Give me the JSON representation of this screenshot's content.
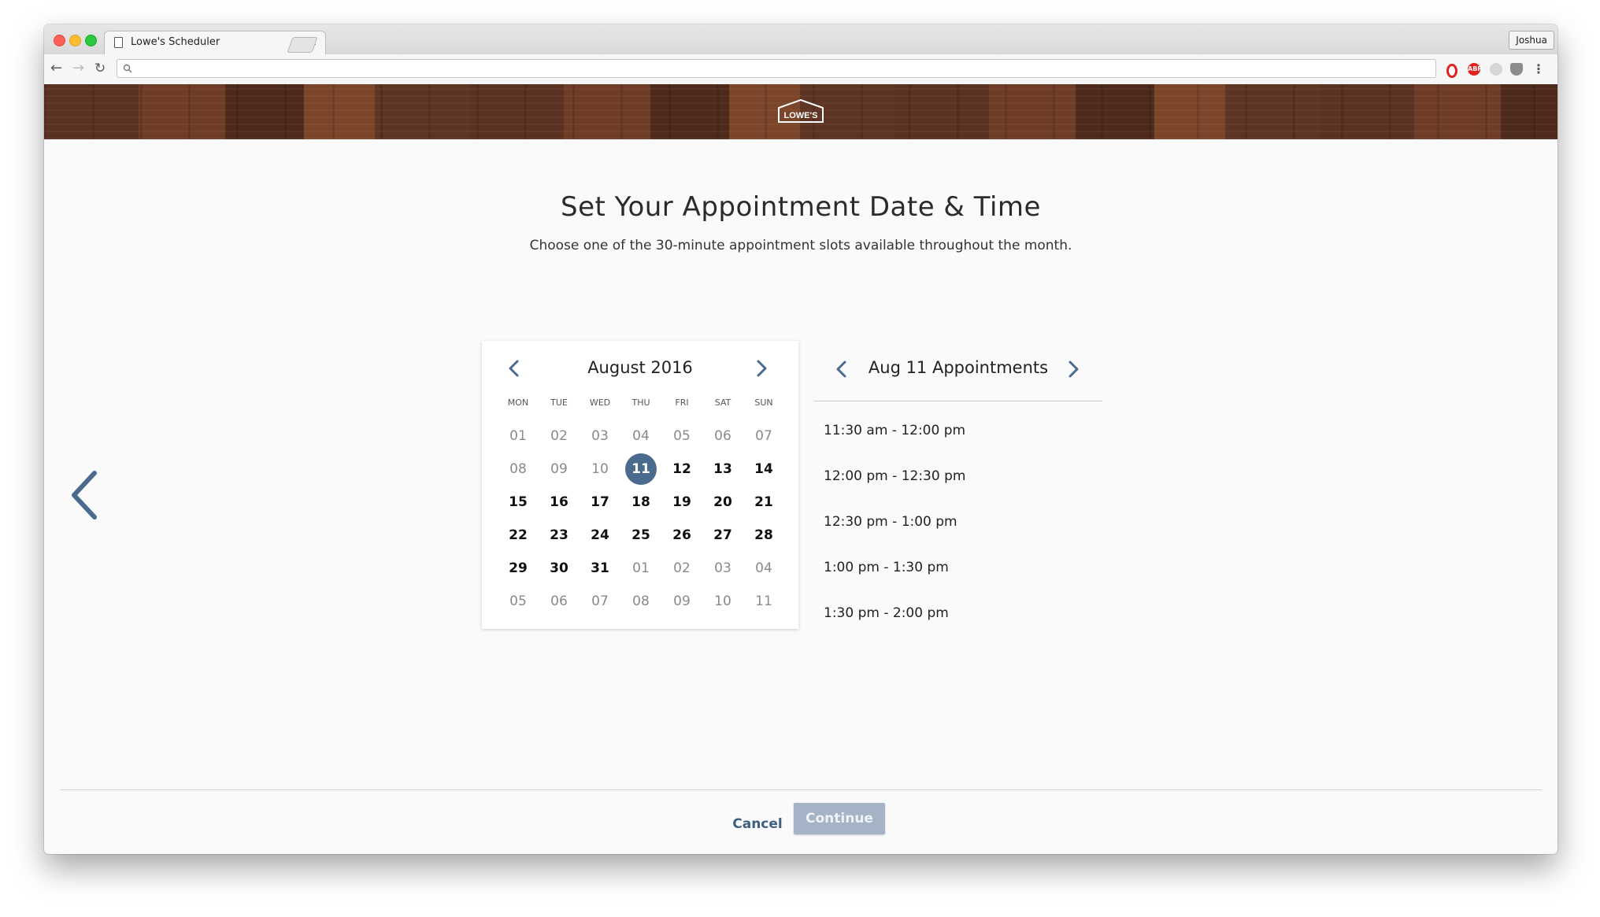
{
  "browser": {
    "tab_title": "Lowe's Scheduler",
    "tab_close": "×",
    "profile_name": "Joshua",
    "address": "",
    "extensions": [
      "opera-icon",
      "adblock-plus-icon",
      "ghostery-icon",
      "privacy-badger-icon",
      "more-menu-icon"
    ],
    "ext_labels": {
      "abp": "ABP",
      "menu": "⋮"
    }
  },
  "banner": {
    "logo_text": "LOWE'S"
  },
  "page": {
    "title": "Set Your Appointment Date & Time",
    "subtitle": "Choose one of the 30-minute appointment slots available throughout the month."
  },
  "calendar": {
    "month_label": "August 2016",
    "weekdays": [
      "MON",
      "TUE",
      "WED",
      "THU",
      "FRI",
      "SAT",
      "SUN"
    ],
    "weeks": [
      [
        {
          "d": "01",
          "s": "muted"
        },
        {
          "d": "02",
          "s": "muted"
        },
        {
          "d": "03",
          "s": "muted"
        },
        {
          "d": "04",
          "s": "muted"
        },
        {
          "d": "05",
          "s": "muted"
        },
        {
          "d": "06",
          "s": "muted"
        },
        {
          "d": "07",
          "s": "muted"
        }
      ],
      [
        {
          "d": "08",
          "s": "muted"
        },
        {
          "d": "09",
          "s": "muted"
        },
        {
          "d": "10",
          "s": "muted"
        },
        {
          "d": "11",
          "s": "sel"
        },
        {
          "d": "12",
          "s": "avail"
        },
        {
          "d": "13",
          "s": "avail"
        },
        {
          "d": "14",
          "s": "avail"
        }
      ],
      [
        {
          "d": "15",
          "s": "avail"
        },
        {
          "d": "16",
          "s": "avail"
        },
        {
          "d": "17",
          "s": "avail"
        },
        {
          "d": "18",
          "s": "avail"
        },
        {
          "d": "19",
          "s": "avail"
        },
        {
          "d": "20",
          "s": "avail"
        },
        {
          "d": "21",
          "s": "avail"
        }
      ],
      [
        {
          "d": "22",
          "s": "avail"
        },
        {
          "d": "23",
          "s": "avail"
        },
        {
          "d": "24",
          "s": "avail"
        },
        {
          "d": "25",
          "s": "avail"
        },
        {
          "d": "26",
          "s": "avail"
        },
        {
          "d": "27",
          "s": "avail"
        },
        {
          "d": "28",
          "s": "avail"
        }
      ],
      [
        {
          "d": "29",
          "s": "avail"
        },
        {
          "d": "30",
          "s": "avail"
        },
        {
          "d": "31",
          "s": "avail"
        },
        {
          "d": "01",
          "s": "muted"
        },
        {
          "d": "02",
          "s": "muted"
        },
        {
          "d": "03",
          "s": "muted"
        },
        {
          "d": "04",
          "s": "muted"
        }
      ],
      [
        {
          "d": "05",
          "s": "muted"
        },
        {
          "d": "06",
          "s": "muted"
        },
        {
          "d": "07",
          "s": "muted"
        },
        {
          "d": "08",
          "s": "muted"
        },
        {
          "d": "09",
          "s": "muted"
        },
        {
          "d": "10",
          "s": "muted"
        },
        {
          "d": "11",
          "s": "muted"
        }
      ]
    ],
    "selected_color": "#4b6b8e"
  },
  "appointments": {
    "title": "Aug 11 Appointments",
    "slots": [
      "11:30 am - 12:00 pm",
      "12:00 pm - 12:30 pm",
      "12:30 pm - 1:00 pm",
      "1:00 pm - 1:30 pm",
      "1:30 pm - 2:00 pm"
    ]
  },
  "footer": {
    "cancel_label": "Cancel",
    "continue_label": "Continue",
    "continue_disabled": true
  },
  "colors": {
    "accent": "#3f5f80",
    "banner_wood": "#5b3222",
    "disabled_button": "#a4b4c6"
  }
}
